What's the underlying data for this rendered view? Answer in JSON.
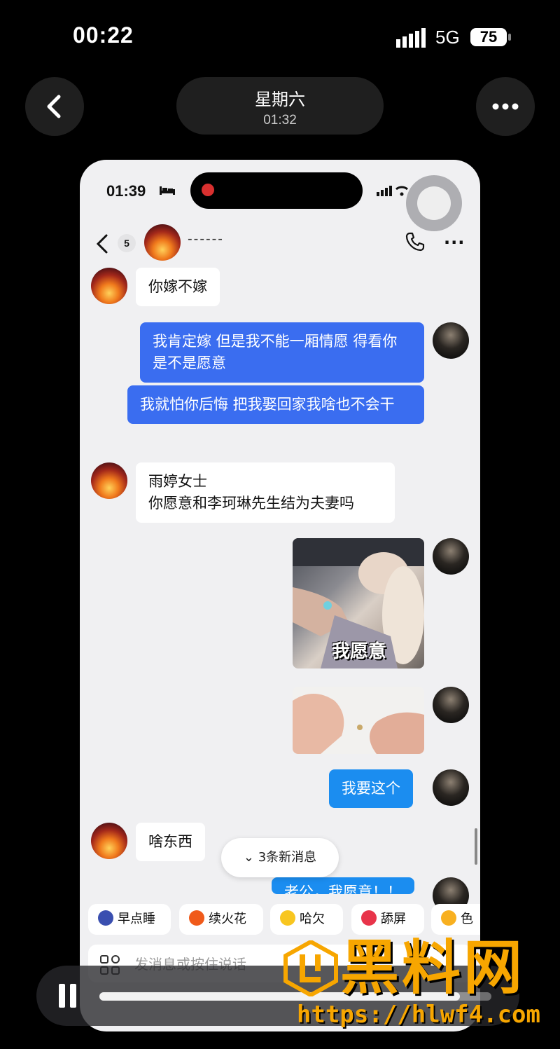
{
  "status_bar": {
    "time": "00:22",
    "network": "5G",
    "battery": "75"
  },
  "header": {
    "title": "星期六",
    "subtitle": "01:32"
  },
  "inner": {
    "status_time": "01:39",
    "chat_header": {
      "unread_count": "5",
      "contact_name": "------"
    },
    "messages": [
      {
        "side": "in",
        "text": "你嫁不嫁"
      },
      {
        "side": "out",
        "text": "我肯定嫁 但是我不能一厢情愿 得看你是不是愿意"
      },
      {
        "side": "out",
        "text": "我就怕你后悔 把我娶回家我啥也不会干"
      },
      {
        "side": "in",
        "text": "雨婷女士\n你愿意和李珂琳先生结为夫妻吗"
      },
      {
        "side": "out",
        "type": "image",
        "caption": "我愿意"
      },
      {
        "side": "out",
        "type": "image",
        "caption": ""
      },
      {
        "side": "out",
        "text": "我要这个"
      },
      {
        "side": "in",
        "text": "啥东西"
      },
      {
        "side": "out",
        "text": "老公，我愿意！！"
      }
    ],
    "new_messages_pill": "3条新消息",
    "quick_replies": [
      {
        "label": "早点睡",
        "icon": "moon-emoji-icon"
      },
      {
        "label": "续火花",
        "icon": "fire-emoji-icon"
      },
      {
        "label": "哈欠",
        "icon": "yawn-emoji-icon"
      },
      {
        "label": "舔屏",
        "icon": "heart-eyes-emoji-icon"
      },
      {
        "label": "色",
        "icon": "heart-eyes-emoji-icon"
      }
    ],
    "input_placeholder": "发消息或按住说话"
  },
  "player": {
    "progress": 0.92
  },
  "watermark": {
    "title": "黑料网",
    "url": "https://hlwf4.com"
  }
}
